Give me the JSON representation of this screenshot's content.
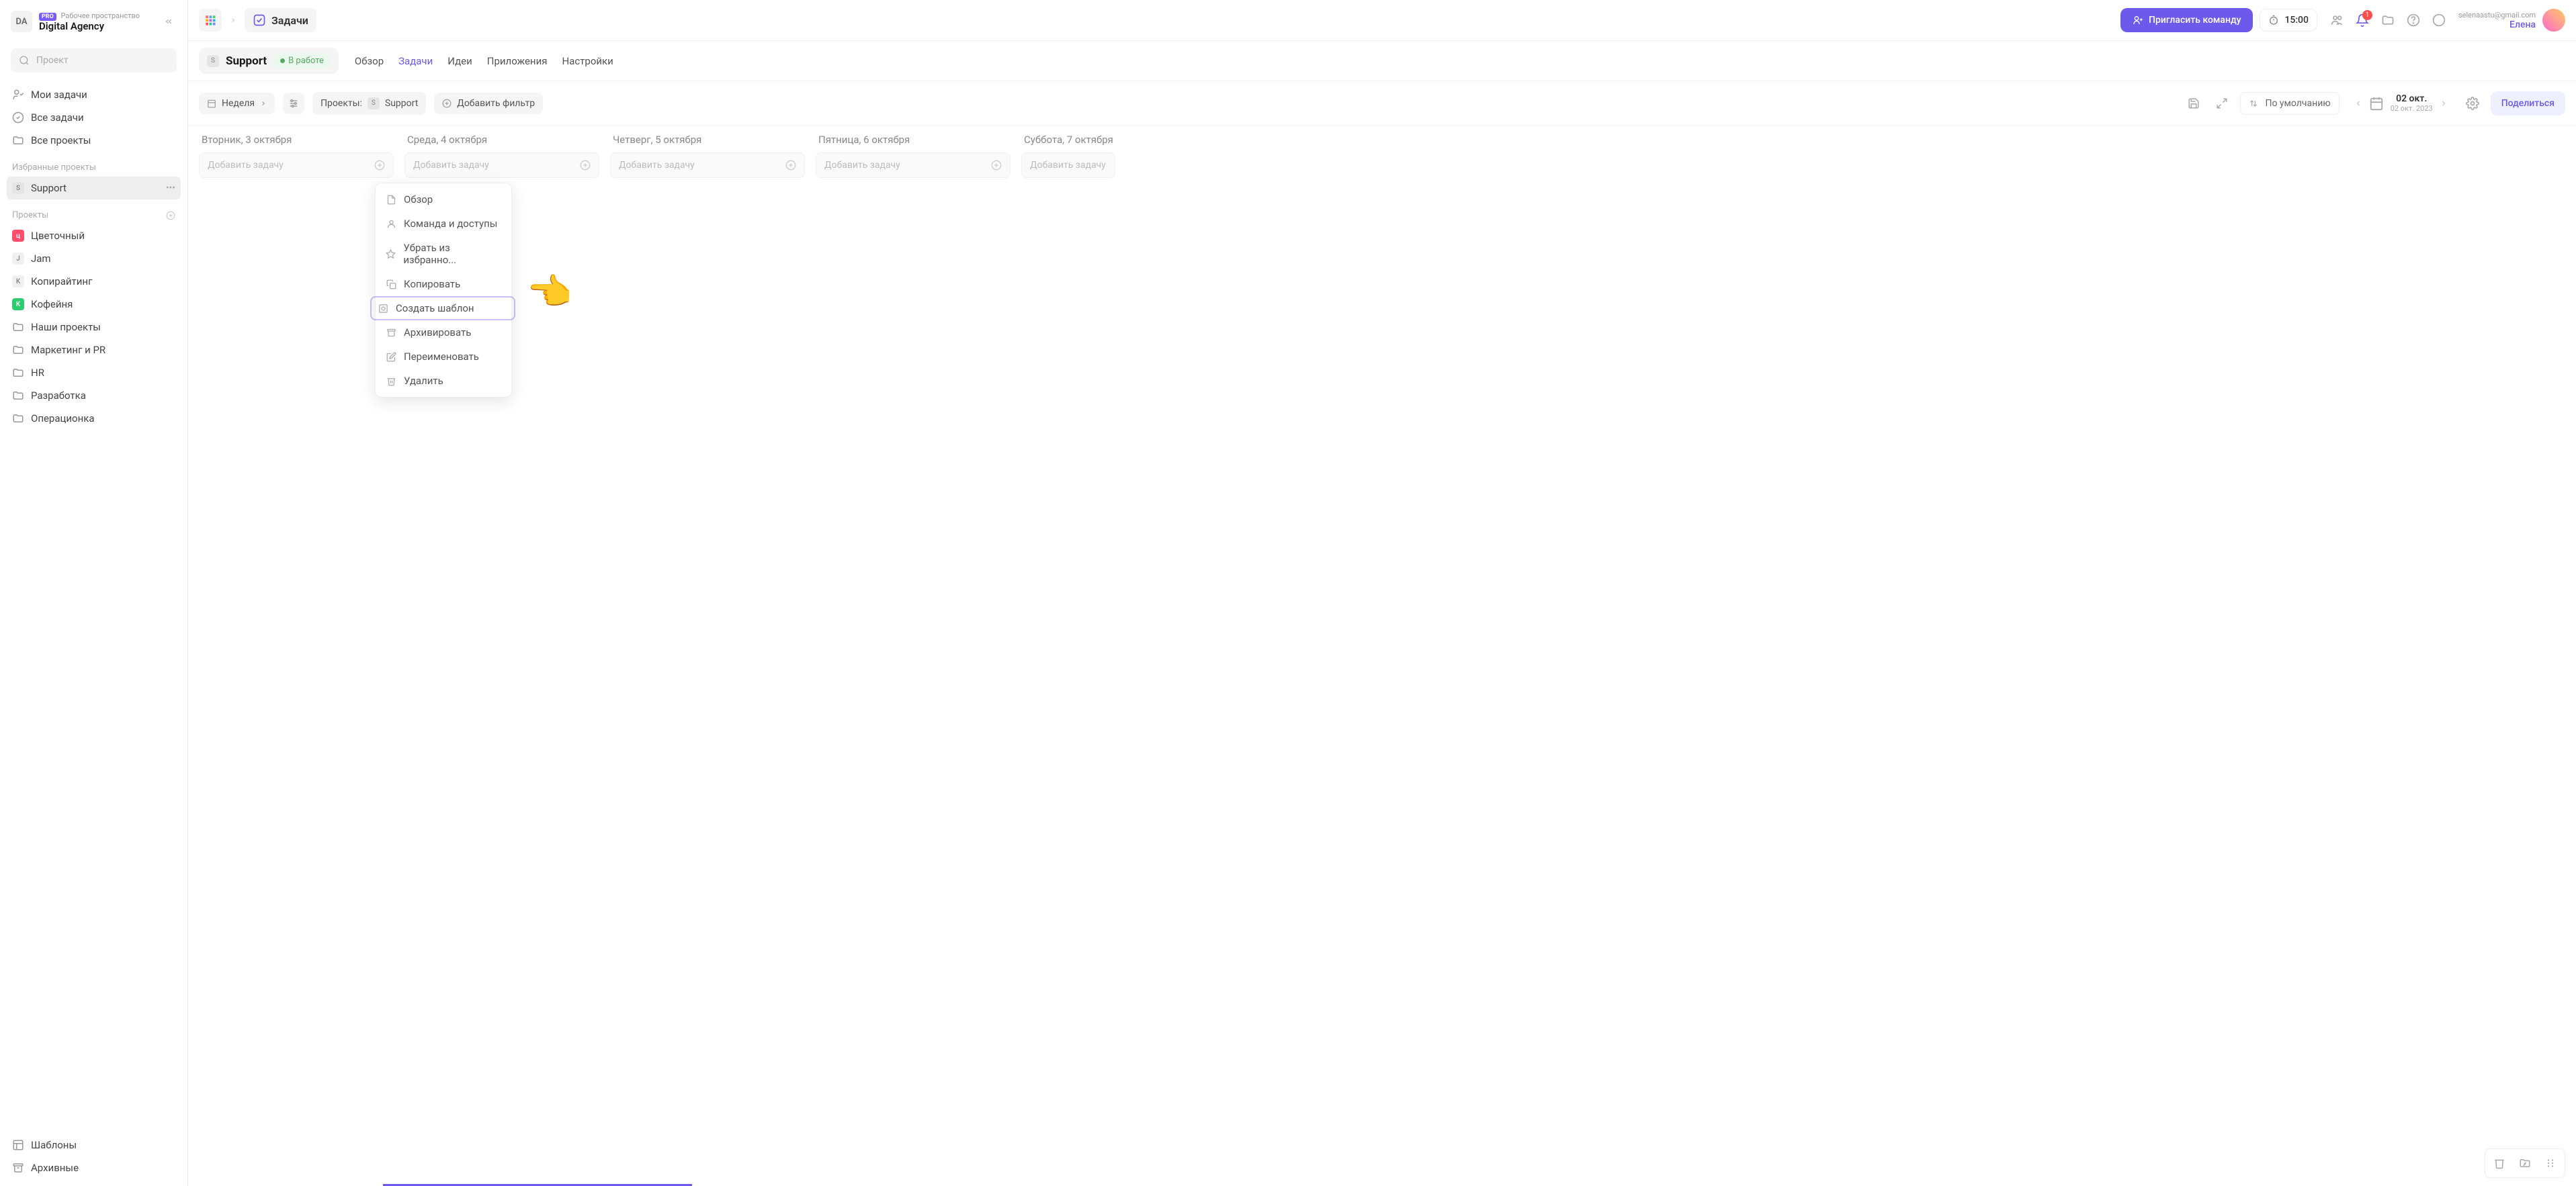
{
  "workspace": {
    "avatar": "DA",
    "badge": "PRO",
    "subtitle": "Рабочее пространство",
    "title": "Digital Agency"
  },
  "search": {
    "placeholder": "Проект"
  },
  "nav": {
    "my_tasks": "Мои задачи",
    "all_tasks": "Все задачи",
    "all_projects": "Все проекты"
  },
  "sections": {
    "favorites": "Избранные проекты",
    "projects": "Проекты"
  },
  "favorites": [
    {
      "abbr": "S",
      "label": "Support",
      "bg": "#e5e5e5",
      "fg": "#888"
    }
  ],
  "projects": [
    {
      "abbr": "ц",
      "label": "Цветочный",
      "bg": "#ff4d6d",
      "fg": "#fff"
    },
    {
      "abbr": "J",
      "label": "Jam",
      "bg": "#f0f0f0",
      "fg": "#888"
    },
    {
      "abbr": "K",
      "label": "Копирайтинг",
      "bg": "#f0f0f0",
      "fg": "#888"
    },
    {
      "abbr": "K",
      "label": "Кофейня",
      "bg": "#2ecc71",
      "fg": "#fff"
    },
    {
      "icon": "folder",
      "label": "Наши проекты"
    },
    {
      "icon": "folder",
      "label": "Маркетинг и PR"
    },
    {
      "icon": "folder",
      "label": "HR"
    },
    {
      "icon": "folder",
      "label": "Разработка"
    },
    {
      "icon": "folder",
      "label": "Операционка"
    }
  ],
  "sidebar_footer": {
    "templates": "Шаблоны",
    "archive": "Архивные"
  },
  "topbar": {
    "module": "Задачи",
    "invite": "Пригласить команду",
    "timer": "15:00",
    "notif_count": "1",
    "user_email": "selenaastu@gmail.com",
    "user_name": "Елена"
  },
  "subheader": {
    "badge": "S",
    "title": "Support",
    "status": "В работе",
    "tabs": [
      "Обзор",
      "Задачи",
      "Идеи",
      "Приложения",
      "Настройки"
    ],
    "active_tab_index": 1
  },
  "filterbar": {
    "view": "Неделя",
    "projects_label": "Проекты:",
    "project_badge": "S",
    "project_name": "Support",
    "add_filter": "Добавить фильтр",
    "sort": "По умолчанию",
    "date_main": "02 окт.",
    "date_sub": "02 окт. 2023",
    "share": "Поделиться"
  },
  "board": {
    "add_placeholder": "Добавить задачу",
    "columns": [
      "Вторник, 3 октября",
      "Среда, 4 октября",
      "Четверг, 5 октября",
      "Пятница, 6 октября",
      "Суббота, 7 октября"
    ]
  },
  "context_menu": {
    "items": [
      "Обзор",
      "Команда и доступы",
      "Убрать из избранно...",
      "Копировать",
      "Создать шаблон",
      "Архивировать",
      "Переименовать",
      "Удалить"
    ],
    "highlighted_index": 4
  }
}
